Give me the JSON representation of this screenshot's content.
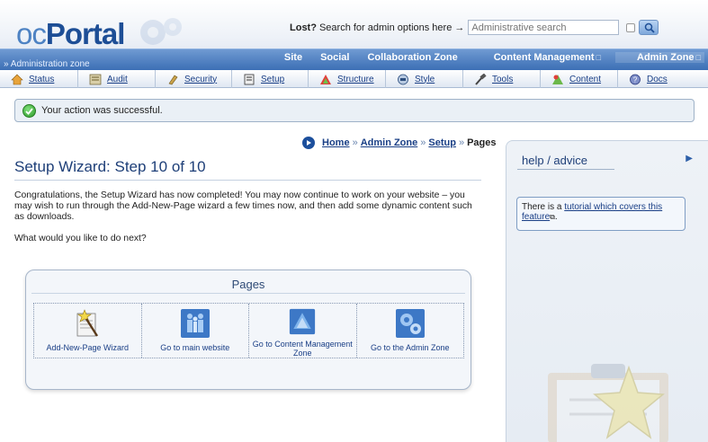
{
  "header": {
    "logo_oc": "oc",
    "logo_portal": "Portal",
    "search_lost": "Lost?",
    "search_text": "Search for admin options here →",
    "search_placeholder": "Administrative search"
  },
  "navbar": {
    "zone_label": "» Administration zone",
    "links": [
      "Site",
      "Social",
      "Collaboration Zone",
      "Content Management",
      "Admin Zone"
    ],
    "menu_indicator": "□"
  },
  "tabs": [
    {
      "label": "Status",
      "icon": "home-icon"
    },
    {
      "label": "Audit",
      "icon": "audit-icon"
    },
    {
      "label": "Security",
      "icon": "security-icon"
    },
    {
      "label": "Setup",
      "icon": "setup-icon"
    },
    {
      "label": "Structure",
      "icon": "structure-icon"
    },
    {
      "label": "Style",
      "icon": "style-icon"
    },
    {
      "label": "Tools",
      "icon": "tools-icon"
    },
    {
      "label": "Content",
      "icon": "content-icon"
    },
    {
      "label": "Docs",
      "icon": "docs-icon"
    }
  ],
  "message": {
    "text": "Your action was successful."
  },
  "breadcrumb": {
    "home": "Home",
    "admin_zone": "Admin Zone",
    "setup": "Setup",
    "current": "Pages",
    "sep": "»"
  },
  "main": {
    "title": "Setup Wizard: Step 10 of 10",
    "intro": "Congratulations, the Setup Wizard has now completed! You may now continue to work on your website – you may wish to run through the Add-New-Page wizard a few times now, and then add some dynamic content such as downloads.",
    "question": "What would you like to do next?"
  },
  "pages_box": {
    "title": "Pages",
    "items": [
      {
        "label": "Add-New-Page Wizard",
        "icon": "wand-icon"
      },
      {
        "label": "Go to main website",
        "icon": "people-icon"
      },
      {
        "label": "Go to Content Management Zone",
        "icon": "cms-icon"
      },
      {
        "label": "Go to the Admin Zone",
        "icon": "admin-gear-icon"
      }
    ]
  },
  "sidebar": {
    "title": "help / advice",
    "help_prefix": "There is a ",
    "help_link": "tutorial which covers this feature",
    "help_suffix": "."
  }
}
